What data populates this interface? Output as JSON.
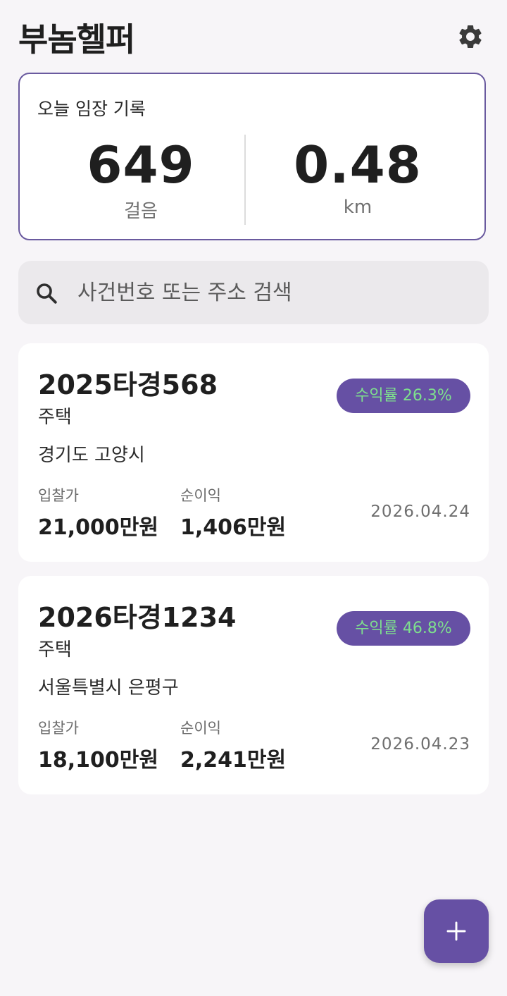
{
  "app": {
    "title": "부놈헬퍼"
  },
  "today_record": {
    "title": "오늘 임장 기록",
    "steps_value": "649",
    "steps_unit": "걸음",
    "distance_value": "0.48",
    "distance_unit": "km"
  },
  "search": {
    "placeholder": "사건번호 또는 주소 검색"
  },
  "cases": [
    {
      "case_number": "2025타경568",
      "type": "주택",
      "address": "경기도 고양시",
      "roi_label": "수익률 26.3%",
      "bid_label": "입찰가",
      "bid_value": "21,000만원",
      "profit_label": "순이익",
      "profit_value": "1,406만원",
      "date": "2026.04.24"
    },
    {
      "case_number": "2026타경1234",
      "type": "주택",
      "address": "서울특별시 은평구",
      "roi_label": "수익률 46.8%",
      "bid_label": "입찰가",
      "bid_value": "18,100만원",
      "profit_label": "순이익",
      "profit_value": "2,241만원",
      "date": "2026.04.23"
    }
  ],
  "icons": {
    "settings": "gear-icon",
    "search": "search-icon",
    "add": "plus-icon"
  },
  "colors": {
    "accent": "#6650a4",
    "roi_text": "#7ee08d",
    "card_border": "#6a5a9f",
    "background": "#f7f5f8"
  }
}
